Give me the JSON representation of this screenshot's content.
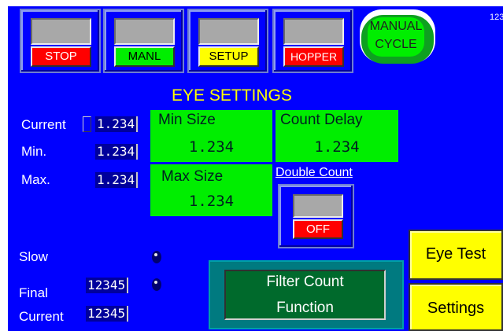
{
  "top_corner": "123",
  "toolbar": {
    "stop": "STOP",
    "manl": "MANL",
    "setup": "SETUP",
    "hopper": "HOPPER",
    "manual_cycle_line1": "MANUAL",
    "manual_cycle_line2": "CYCLE"
  },
  "title": "EYE SETTINGS",
  "eye": {
    "current_label": "Current",
    "current_value": "1.234",
    "min_label": "Min.",
    "min_value": "1.234",
    "max_label": "Max.",
    "max_value": "1.234"
  },
  "min_size": {
    "label": "Min Size",
    "value": "1.234"
  },
  "count_delay": {
    "label": "Count Delay",
    "value": "1.234"
  },
  "max_size": {
    "label": "Max Size",
    "value": "1.234"
  },
  "double_count": {
    "label": "Double Count",
    "state": "OFF"
  },
  "counts": {
    "slow_label": "Slow",
    "final_label": "Final",
    "final_value": "12345",
    "current_label": "Current",
    "current_value": "12345"
  },
  "filter": {
    "line1": "Filter Count",
    "line2": "Function"
  },
  "buttons": {
    "eye_test": "Eye Test",
    "settings": "Settings"
  },
  "colors": {
    "background": "#0000ff",
    "stop": "#ff0000",
    "manl": "#00ee00",
    "setup": "#ffff00",
    "hopper": "#ff0000",
    "green_box": "#00ee00",
    "yellow_button": "#ffff00",
    "filter_box": "#006a2c"
  }
}
